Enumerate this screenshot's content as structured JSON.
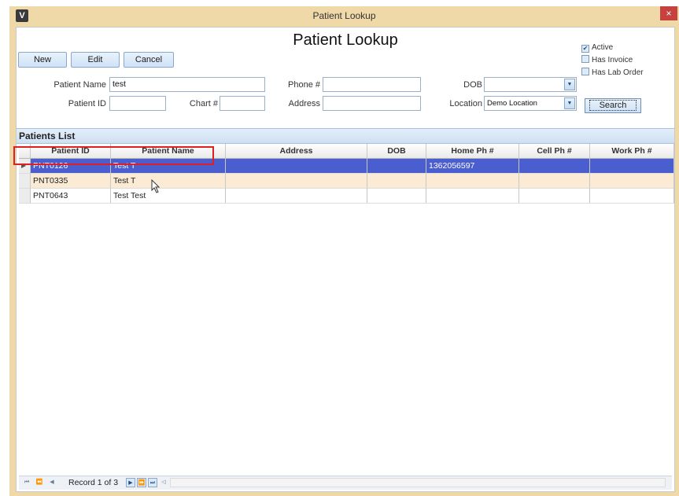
{
  "window": {
    "title": "Patient Lookup",
    "app_icon": "V",
    "close_glyph": "×"
  },
  "form": {
    "title": "Patient Lookup",
    "buttons": {
      "new": "New",
      "edit": "Edit",
      "cancel": "Cancel",
      "search": "Search"
    },
    "labels": {
      "patient_name": "Patient Name",
      "patient_id": "Patient ID",
      "chart": "Chart  #",
      "phone": "Phone #",
      "address": "Address",
      "dob": "DOB",
      "location": "Location"
    },
    "values": {
      "patient_name": "test",
      "patient_id": "",
      "chart": "",
      "phone": "",
      "address": "",
      "dob": "",
      "location": "Demo Location"
    },
    "filters": [
      {
        "label": "Active",
        "checked": true
      },
      {
        "label": "Has Invoice",
        "checked": false
      },
      {
        "label": "Has Lab Order",
        "checked": false
      }
    ]
  },
  "patients_list": {
    "title": "Patients List",
    "columns": [
      "Patient ID",
      "Patient Name",
      "Address",
      "DOB",
      "Home Ph #",
      "Cell Ph #",
      "Work Ph #"
    ],
    "rows": [
      [
        "PNT0126",
        "Test T",
        "",
        "",
        "1362056597",
        "",
        ""
      ],
      [
        "PNT0335",
        "Test T",
        "",
        "",
        "",
        "",
        ""
      ],
      [
        "PNT0643",
        "Test Test",
        "",
        "",
        "",
        "",
        ""
      ]
    ],
    "selected_index": 0
  },
  "navigator": {
    "record_text": "Record 1 of 3"
  }
}
